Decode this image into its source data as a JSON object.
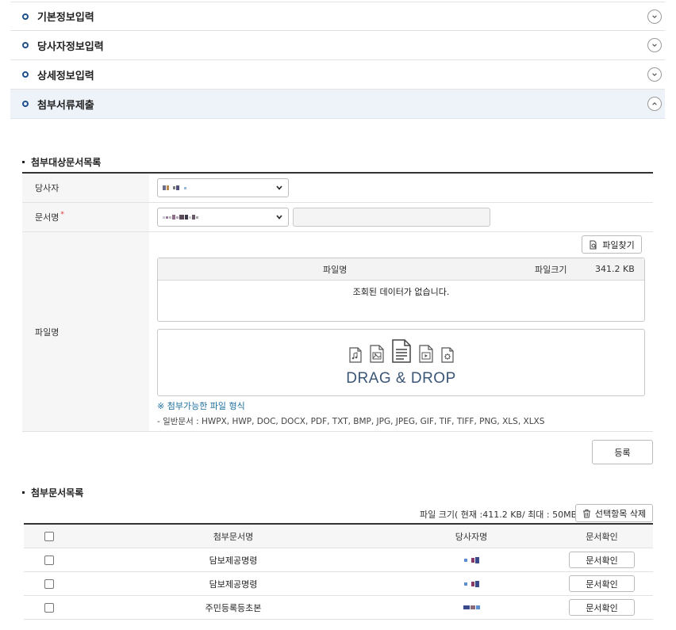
{
  "accordion": [
    {
      "title": "기본정보입력",
      "expanded": false
    },
    {
      "title": "당사자정보입력",
      "expanded": false
    },
    {
      "title": "상세정보입력",
      "expanded": false
    },
    {
      "title": "첨부서류제출",
      "expanded": true
    }
  ],
  "attach_target": {
    "heading": "첨부대상문서목록",
    "party_label": "당사자",
    "docname_label": "문서명",
    "required_mark": "*",
    "filename_label": "파일명",
    "find_file_button": "파일찾기",
    "file_table": {
      "col_filename": "파일명",
      "col_filesize": "파일크기",
      "filesize_value": "341.2 KB",
      "empty_message": "조회된 데이터가 없습니다."
    },
    "dropzone_text": "DRAG & DROP",
    "allowed_title": "※ 첨부가능한 파일 형식",
    "allowed_list": "- 일반문서 : HWPX, HWP, DOC, DOCX, PDF, TXT, BMP, JPG, JPEG, GIF, TIF, TIFF, PNG, XLS, XLXS",
    "register_button": "등록"
  },
  "attach_list": {
    "heading": "첨부문서목록",
    "size_info": "파일 크기( 현재 :411.2 KB/ 최대 : 50MB)",
    "delete_button": "선택항목 삭제",
    "columns": {
      "doc": "첨부문서명",
      "party": "당사자명",
      "confirm": "문서확인"
    },
    "rows": [
      {
        "doc": "담보제공명령",
        "button": "문서확인"
      },
      {
        "doc": "담보제공명령",
        "button": "문서확인"
      },
      {
        "doc": "주민등록등초본",
        "button": "문서확인"
      }
    ]
  },
  "colors": {
    "accent": "#1f4f8b",
    "allowed_title": "#1d6e9e",
    "dd_text": "#3b5676"
  }
}
